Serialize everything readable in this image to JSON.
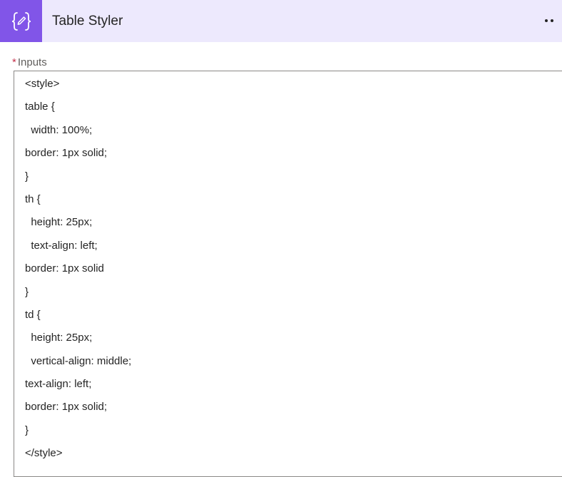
{
  "header": {
    "icon": "curly-braces-pencil-icon",
    "title": "Table Styler",
    "more_icon": "more-options-icon",
    "icon_bg_color": "#8155e8",
    "header_bg_color": "#ede9fd"
  },
  "field": {
    "required_mark": "*",
    "label": "Inputs",
    "lines": [
      "<style>",
      "table {",
      "  width: 100%;",
      "border: 1px solid;",
      "}",
      "th {",
      "  height: 25px;",
      "  text-align: left;",
      "border: 1px solid",
      "}",
      "td {",
      "  height: 25px;",
      "  vertical-align: middle;",
      "text-align: left;",
      "border: 1px solid;",
      "}",
      "</style>"
    ]
  }
}
